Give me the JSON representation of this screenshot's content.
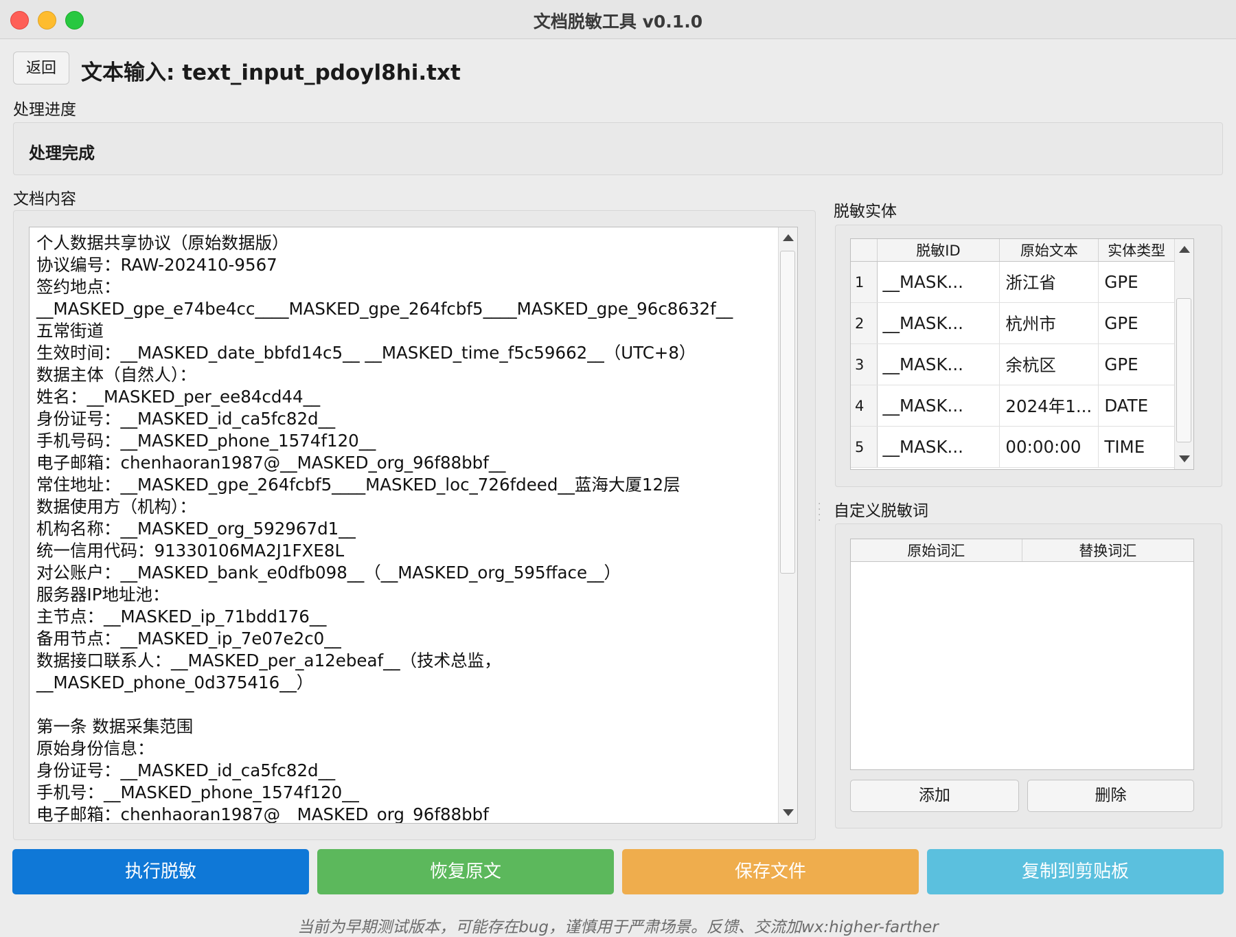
{
  "window": {
    "title": "文档脱敏工具 v0.1.0"
  },
  "header": {
    "back_label": "返回",
    "title": "文本输入: text_input_pdoyl8hi.txt"
  },
  "progress": {
    "section_label": "处理进度",
    "status": "处理完成"
  },
  "document": {
    "section_label": "文档内容",
    "lines": [
      "个人数据共享协议（原始数据版）",
      "协议编号：RAW-202410-9567",
      "签约地点：",
      "__MASKED_gpe_e74be4cc____MASKED_gpe_264fcbf5____MASKED_gpe_96c8632f__",
      "五常街道",
      "生效时间：__MASKED_date_bbfd14c5__ __MASKED_time_f5c59662__（UTC+8）",
      "数据主体（自然人）：",
      "姓名：__MASKED_per_ee84cd44__",
      "身份证号：__MASKED_id_ca5fc82d__",
      "手机号码：__MASKED_phone_1574f120__",
      "电子邮箱：chenhaoran1987@__MASKED_org_96f88bbf__",
      "常住地址：__MASKED_gpe_264fcbf5____MASKED_loc_726fdeed__蓝海大厦12层",
      "数据使用方（机构）：",
      "机构名称：__MASKED_org_592967d1__",
      "统一信用代码：91330106MA2J1FXE8L",
      "对公账户：__MASKED_bank_e0dfb098__（__MASKED_org_595fface__）",
      "服务器IP地址池：",
      "主节点：__MASKED_ip_71bdd176__",
      "备用节点：__MASKED_ip_7e07e2c0__",
      "数据接口联系人：__MASKED_per_a12ebeaf__（技术总监，",
      "__MASKED_phone_0d375416__）",
      "",
      "第一条 数据采集范围",
      "原始身份信息：",
      "身份证号：__MASKED_id_ca5fc82d__",
      "手机号：__MASKED_phone_1574f120__",
      "电子邮箱：chenhaoran1987@__MASKED_org_96f88bbf"
    ]
  },
  "entities": {
    "section_label": "脱敏实体",
    "columns": [
      "脱敏ID",
      "原始文本",
      "实体类型"
    ],
    "rows": [
      {
        "num": "1",
        "id": "__MASK...",
        "text": "浙江省",
        "type": "GPE"
      },
      {
        "num": "2",
        "id": "__MASK...",
        "text": "杭州市",
        "type": "GPE"
      },
      {
        "num": "3",
        "id": "__MASK...",
        "text": "余杭区",
        "type": "GPE"
      },
      {
        "num": "4",
        "id": "__MASK...",
        "text": "2024年1...",
        "type": "DATE"
      },
      {
        "num": "5",
        "id": "__MASK...",
        "text": "00:00:00",
        "type": "TIME"
      }
    ]
  },
  "custom_words": {
    "section_label": "自定义脱敏词",
    "columns": [
      "原始词汇",
      "替换词汇"
    ],
    "add_label": "添加",
    "delete_label": "删除"
  },
  "actions": {
    "execute": "执行脱敏",
    "restore": "恢复原文",
    "save": "保存文件",
    "copy": "复制到剪贴板"
  },
  "colors": {
    "execute": "#0f78d7",
    "restore": "#5cb85c",
    "save": "#efad4d",
    "copy": "#5bc0de"
  },
  "footer": {
    "notice": "当前为早期测试版本，可能存在bug，谨慎用于严肃场景。反馈、交流加wx:higher-farther"
  }
}
